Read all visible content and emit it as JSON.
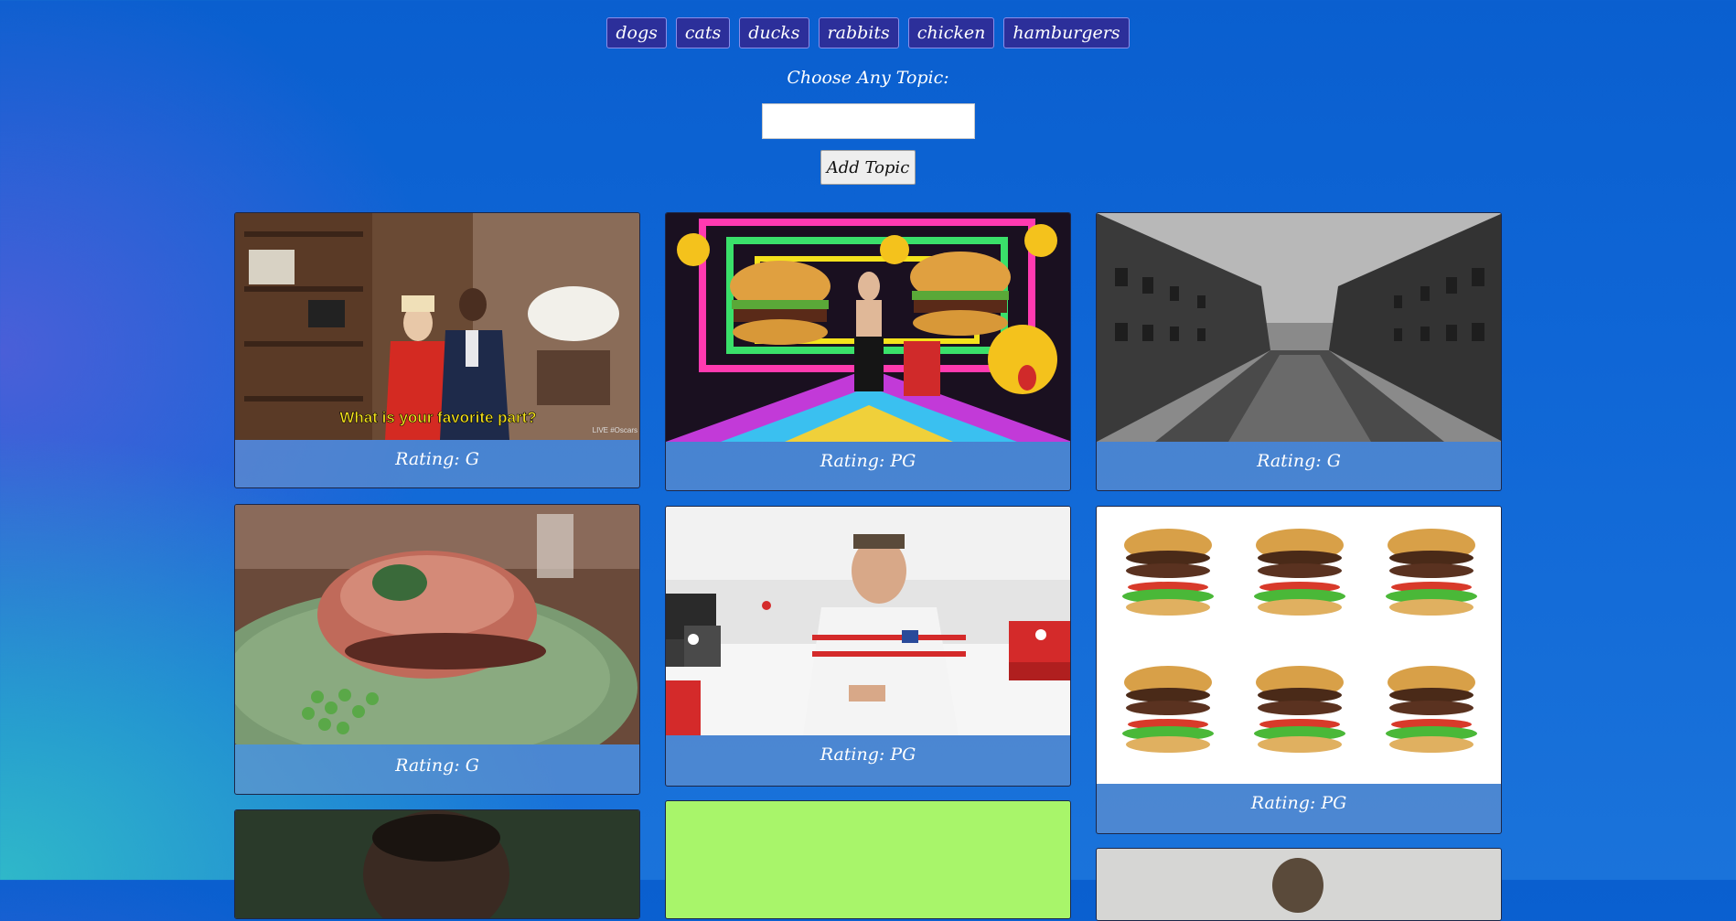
{
  "topics": [
    "dogs",
    "cats",
    "ducks",
    "rabbits",
    "chicken",
    "hamburgers"
  ],
  "form": {
    "label": "Choose Any Topic:",
    "input_value": "",
    "input_placeholder": "",
    "button_label": "Add Topic"
  },
  "gifs": [
    {
      "rating_text": "Rating: G",
      "caption": "What is your favorite part?",
      "watermark": "LIVE\n#Oscars"
    },
    {
      "rating_text": "Rating: PG"
    },
    {
      "rating_text": "Rating: G"
    },
    {
      "rating_text": "Rating: G"
    },
    {
      "rating_text": "Rating: PG"
    },
    {
      "rating_text": "Rating: PG"
    },
    {
      "rating_text": ""
    },
    {
      "rating_text": ""
    },
    {
      "rating_text": ""
    }
  ]
}
